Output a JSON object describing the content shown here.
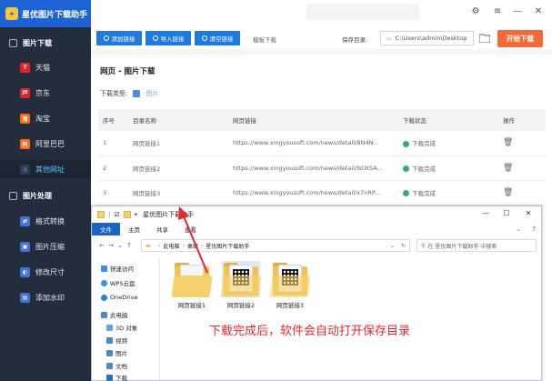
{
  "app": {
    "title": "星优图片下载助手",
    "logo_glyph": "✦"
  },
  "sidebar": {
    "sections": [
      {
        "label": "图片下载",
        "items": [
          {
            "label": "天猫",
            "badge": "T",
            "color": "#e4202b"
          },
          {
            "label": "京东",
            "badge": "JD",
            "color": "#e4202b"
          },
          {
            "label": "淘宝",
            "badge": "淘",
            "color": "#ff6a13"
          },
          {
            "label": "阿里巴巴",
            "badge": "阿",
            "color": "#ff6a13"
          },
          {
            "label": "其他网址",
            "badge": "◎",
            "color": "#5fc3ff",
            "active": true
          }
        ]
      },
      {
        "label": "图片处理",
        "items": [
          {
            "label": "格式转换",
            "badge": "⇄",
            "color": "#3f74d8"
          },
          {
            "label": "图片压缩",
            "badge": "▣",
            "color": "#3f74d8"
          },
          {
            "label": "修改尺寸",
            "badge": "◐",
            "color": "#3f74d8"
          },
          {
            "label": "添加水印",
            "badge": "▤",
            "color": "#3f74d8"
          }
        ]
      }
    ]
  },
  "toolbar": {
    "add_link": "添加链接",
    "import_link": "导入链接",
    "clear_link": "清空链接",
    "template_download": "模板下载",
    "save_dir_label": "保存目录:",
    "save_dir_value": "C:\\Users\\admin\\Desktop",
    "start_button": "开始下载"
  },
  "main": {
    "panel_title": "网页 - 图片下载",
    "download_type_label": "下载类型:",
    "download_type_option": "图片",
    "table": {
      "headers": [
        "序号",
        "目录名称",
        "网页链接",
        "下载状态",
        "操作"
      ],
      "rows": [
        {
          "index": "1",
          "name": "网页链接1",
          "url": "https://www.xingyousoft.com/news/detail/BN4N...",
          "status": "下载完成"
        },
        {
          "index": "2",
          "name": "网页链接2",
          "url": "https://www.xingyousoft.com/news/detail/NOkSA...",
          "status": "下载完成"
        },
        {
          "index": "3",
          "name": "网页链接3",
          "url": "https://www.xingyousoft.com/news/detail/x7nRP...",
          "status": "下载完成"
        }
      ]
    }
  },
  "explorer": {
    "title": "星优图片下载助手",
    "tabs": [
      "文件",
      "主页",
      "共享",
      "查看"
    ],
    "breadcrumb": [
      "此电脑",
      "桌面",
      "星优图片下载助手"
    ],
    "search_placeholder": "在 星优图片下载助手 中搜索",
    "nav_items": [
      {
        "label": "快速访问",
        "color": "#3a8ee6"
      },
      {
        "label": "WPS云盘",
        "color": "#3a8ee6"
      },
      {
        "label": "OneDrive",
        "color": "#2a7fd4"
      },
      {
        "label": "此电脑",
        "color": "#4e88c8"
      },
      {
        "label": "3D 对象",
        "color": "#5fa8e8"
      },
      {
        "label": "视频",
        "color": "#4e88c8"
      },
      {
        "label": "图片",
        "color": "#4e88c8"
      },
      {
        "label": "文档",
        "color": "#4e88c8"
      },
      {
        "label": "下载",
        "color": "#2a6fc4"
      }
    ],
    "files": [
      {
        "name": "网页链接1"
      },
      {
        "name": "网页链接2",
        "selected": true
      },
      {
        "name": "网页链接3"
      }
    ]
  },
  "annotation": "下载完成后，软件会自动打开保存目录",
  "colors": {
    "sidebar_bg": "#232d3d",
    "brand_blue": "#1e63d6",
    "start_orange": "#f56838",
    "success_green": "#2fb36b",
    "annotation_red": "#e8262e"
  }
}
